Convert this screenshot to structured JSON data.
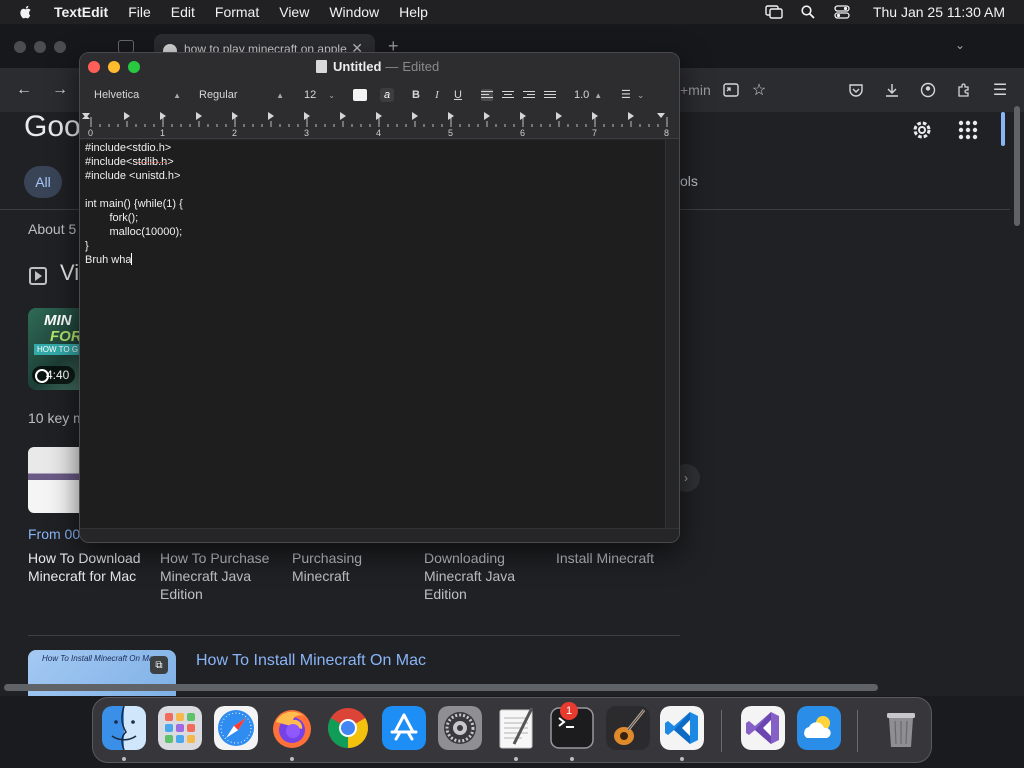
{
  "menubar": {
    "app_name": "TextEdit",
    "menus": [
      "File",
      "Edit",
      "Format",
      "View",
      "Window",
      "Help"
    ],
    "clock": "Thu Jan 25  11:30 AM"
  },
  "browser": {
    "tab_title": "how to play minecraft on apple",
    "url_fragment": "+min",
    "google_logo": "Goo",
    "filter_all": "All",
    "filter_tools": "ols",
    "about": "About 5",
    "section_title": "Vi",
    "video_duration": "4:40",
    "thumb_text_1": "MIN",
    "thumb_text_2": "FOR",
    "thumb_text_3": "HOW TO G",
    "key_moments": "10 key m",
    "from_label": "From 00",
    "moments": [
      "How To Download Minecraft for Mac",
      "How To Purchase Minecraft Java Edition",
      "Purchasing Minecraft",
      "Downloading Minecraft Java Edition",
      "Install Minecraft"
    ],
    "result_thumb_caption": "How To Install Minecraft On Mac",
    "result_title": "How To Install Minecraft On Mac"
  },
  "textedit": {
    "doc_name": "Untitled",
    "separator": "—",
    "status": "Edited",
    "font_family": "Helvetica",
    "font_style": "Regular",
    "font_size": "12",
    "line_spacing": "1.0",
    "ruler_numbers": [
      "0",
      "1",
      "2",
      "3",
      "4",
      "5",
      "6",
      "7",
      "8"
    ],
    "lines": [
      "#include<stdio.h>",
      "#include<stdlib.h>",
      "#include <unistd.h>",
      "",
      "int main() {while(1) {",
      "        fork();",
      "        malloc(10000);",
      "}",
      "Bruh wha"
    ]
  },
  "dock": {
    "settings_badge": "1",
    "apps": [
      "finder-icon",
      "launchpad-icon",
      "safari-icon",
      "firefox-icon",
      "chrome-icon",
      "app-store-icon",
      "system-settings-icon",
      "textedit-icon",
      "terminal-icon",
      "garageband-icon",
      "vscode-icon",
      "visual-studio-icon",
      "weather-icon",
      "trash-icon"
    ]
  },
  "colors": {
    "close": "#ff5f57",
    "minimize": "#febc2e",
    "maximize": "#28c840",
    "link": "#8ab4f8",
    "badge": "#e93a30"
  }
}
